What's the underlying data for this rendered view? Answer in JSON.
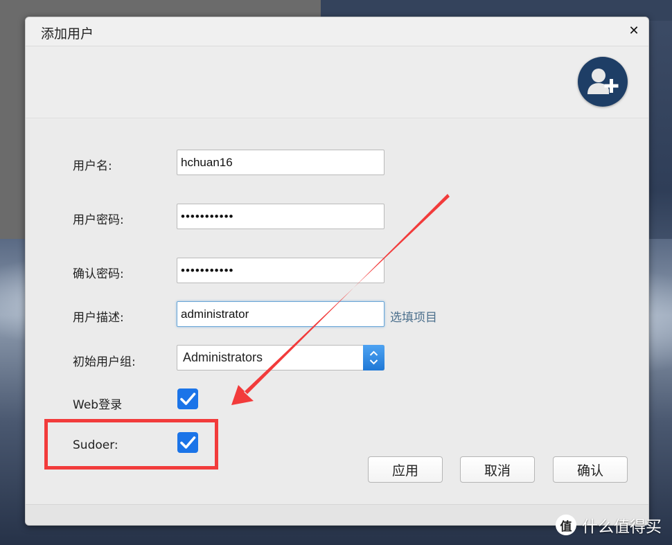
{
  "dialog": {
    "title": "添加用户"
  },
  "form": {
    "username": {
      "label": "用户名:",
      "value": "hchuan16"
    },
    "password": {
      "label": "用户密码:",
      "value": "•••••••••••"
    },
    "confirm_password": {
      "label": "确认密码:",
      "value": "•••••••••••"
    },
    "description": {
      "label": "用户描述:",
      "value": "administrator",
      "hint": "选填项目"
    },
    "group": {
      "label": "初始用户组:",
      "selected": "Administrators"
    },
    "web_login": {
      "label": "Web登录",
      "checked": true
    },
    "sudoer": {
      "label": "Sudoer:",
      "checked": true
    }
  },
  "buttons": {
    "apply": "应用",
    "cancel": "取消",
    "confirm": "确认"
  },
  "icons": {
    "close": "close-icon",
    "add_user": "add-user-icon",
    "check": "checkmark-icon",
    "select_arrows": "updown-arrows-icon"
  },
  "colors": {
    "accent": "#1b74e8",
    "highlight": "#f23b3b",
    "hint": "#4b6f8c"
  },
  "watermark": {
    "logo": "值",
    "text": "什么值得买"
  }
}
